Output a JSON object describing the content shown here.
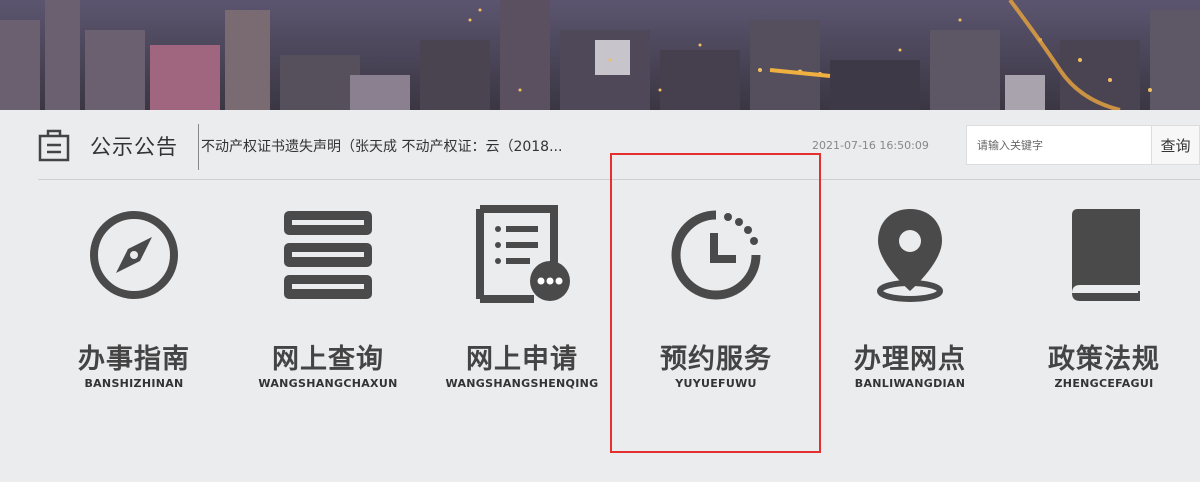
{
  "notice": {
    "title": "公示公告",
    "text": "不动产权证书遗失声明（张天成 不动产权证：云（2018...",
    "date": "2021-07-16 16:50:09"
  },
  "search": {
    "placeholder": "请输入关键字",
    "button": "查询"
  },
  "services": [
    {
      "cn": "办事指南",
      "en": "BANSHIZHINAN",
      "icon": "compass-icon"
    },
    {
      "cn": "网上查询",
      "en": "WANGSHANGCHAXUN",
      "icon": "server-list-icon"
    },
    {
      "cn": "网上申请",
      "en": "WANGSHANGSHENQING",
      "icon": "document-chat-icon"
    },
    {
      "cn": "预约服务",
      "en": "YUYUEFUWU",
      "icon": "clock-icon"
    },
    {
      "cn": "办理网点",
      "en": "BANLIWANGDIAN",
      "icon": "location-pin-icon"
    },
    {
      "cn": "政策法规",
      "en": "ZHENGCEFAGUI",
      "icon": "book-icon"
    }
  ],
  "colors": {
    "background": "#ebecee",
    "icon": "#4a4a4a",
    "highlight": "#e53030"
  }
}
